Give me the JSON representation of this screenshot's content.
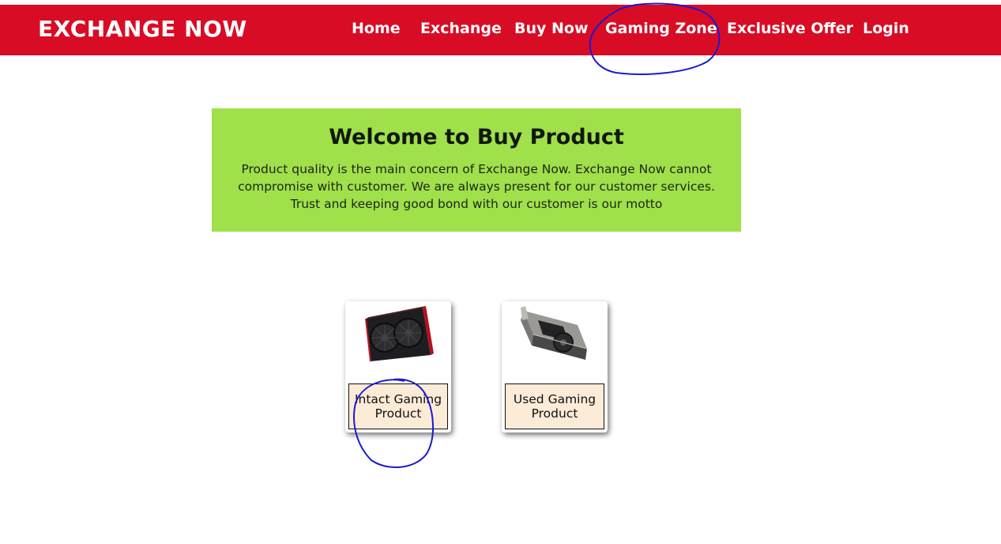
{
  "header": {
    "brand": "EXCHANGE NOW",
    "nav": [
      "Home",
      "Exchange",
      "Buy Now",
      "Gaming Zone",
      "Exclusive Offer",
      "Login"
    ]
  },
  "hero": {
    "title": "Welcome to Buy Product",
    "text": "Product quality is the main concern of Exchange Now. Exchange Now cannot compromise with customer. We are always present for our customer services. Trust and keeping good bond with our customer is our motto"
  },
  "products": [
    {
      "label": "Intact Gaming Product",
      "image": "red-black-graphics-card"
    },
    {
      "label": "Used Gaming Product",
      "image": "silver-graphics-card"
    }
  ],
  "colors": {
    "header_bg": "#d90c25",
    "hero_bg": "#a0e04a",
    "label_bg": "#fbebd7",
    "annotation": "#1a1ad0"
  }
}
